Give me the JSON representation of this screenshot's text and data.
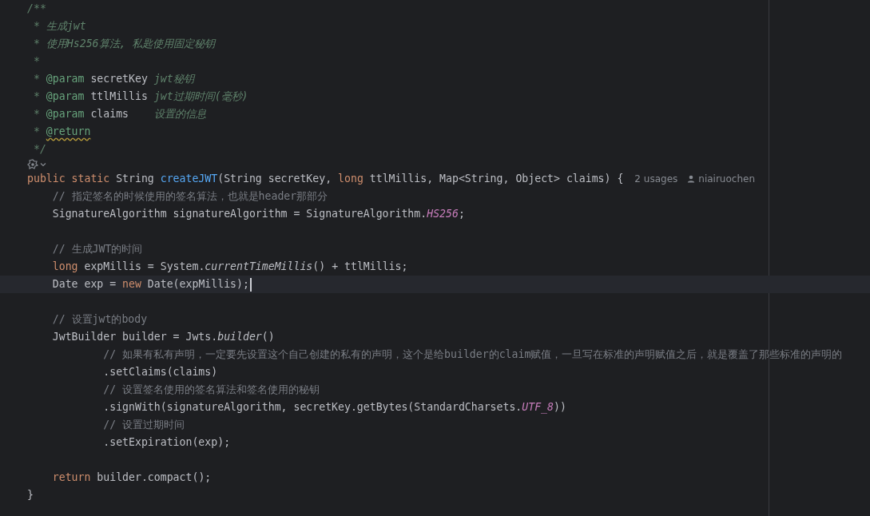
{
  "editor": {
    "lines": [
      {
        "kind": "code",
        "current": false,
        "tokens": [
          {
            "kind": "doc",
            "text": "/**"
          }
        ]
      },
      {
        "kind": "code",
        "current": false,
        "tokens": [
          {
            "kind": "doc",
            "text": " * 生成jwt"
          }
        ]
      },
      {
        "kind": "code",
        "current": false,
        "tokens": [
          {
            "kind": "doc",
            "text": " * 使用Hs256算法, 私匙使用固定秘钥"
          }
        ]
      },
      {
        "kind": "code",
        "current": false,
        "tokens": [
          {
            "kind": "doc",
            "text": " *"
          }
        ]
      },
      {
        "kind": "code",
        "current": false,
        "tokens": [
          {
            "kind": "doc",
            "text": " * "
          },
          {
            "kind": "doctag",
            "text": "@param"
          },
          {
            "kind": "docparam",
            "text": " secretKey"
          },
          {
            "kind": "doc",
            "text": " jwt秘钥"
          }
        ]
      },
      {
        "kind": "code",
        "current": false,
        "tokens": [
          {
            "kind": "doc",
            "text": " * "
          },
          {
            "kind": "doctag",
            "text": "@param"
          },
          {
            "kind": "docparam",
            "text": " ttlMillis"
          },
          {
            "kind": "doc",
            "text": " jwt过期时间(毫秒)"
          }
        ]
      },
      {
        "kind": "code",
        "current": false,
        "tokens": [
          {
            "kind": "doc",
            "text": " * "
          },
          {
            "kind": "doctag",
            "text": "@param"
          },
          {
            "kind": "docparam",
            "text": " claims"
          },
          {
            "kind": "doc",
            "text": "    设置的信息"
          }
        ]
      },
      {
        "kind": "code",
        "current": false,
        "tokens": [
          {
            "kind": "doc",
            "text": " * "
          },
          {
            "kind": "doctag-warn",
            "text": "@return"
          }
        ]
      },
      {
        "kind": "code",
        "current": false,
        "tokens": [
          {
            "kind": "doc",
            "text": " */"
          }
        ]
      },
      {
        "kind": "marker",
        "current": false
      },
      {
        "kind": "code",
        "current": false,
        "tokens": [
          {
            "kind": "keyword",
            "text": "public static "
          },
          {
            "kind": "plain",
            "text": "String "
          },
          {
            "kind": "method",
            "text": "createJWT"
          },
          {
            "kind": "plain",
            "text": "(String secretKey, "
          },
          {
            "kind": "keyword",
            "text": "long "
          },
          {
            "kind": "plain",
            "text": "ttlMillis, Map<String, Object> claims) {"
          }
        ],
        "usages": "2 usages",
        "author": "niairuochen"
      },
      {
        "kind": "code",
        "current": false,
        "tokens": [
          {
            "kind": "comment",
            "text": "    // 指定签名的时候使用的签名算法，也就是header那部分"
          }
        ]
      },
      {
        "kind": "code",
        "current": false,
        "tokens": [
          {
            "kind": "plain",
            "text": "    SignatureAlgorithm signatureAlgorithm = SignatureAlgorithm."
          },
          {
            "kind": "constant",
            "text": "HS256"
          },
          {
            "kind": "plain",
            "text": ";"
          }
        ]
      },
      {
        "kind": "code",
        "current": false
      },
      {
        "kind": "code",
        "current": false,
        "tokens": [
          {
            "kind": "comment",
            "text": "    // 生成JWT的时间"
          }
        ]
      },
      {
        "kind": "code",
        "current": false,
        "tokens": [
          {
            "kind": "keyword",
            "text": "    long "
          },
          {
            "kind": "plain",
            "text": "expMillis = System."
          },
          {
            "kind": "static",
            "text": "currentTimeMillis"
          },
          {
            "kind": "plain",
            "text": "() + ttlMillis;"
          }
        ]
      },
      {
        "kind": "code",
        "current": true,
        "tokens": [
          {
            "kind": "plain",
            "text": "    Date exp = "
          },
          {
            "kind": "keyword",
            "text": "new "
          },
          {
            "kind": "plain",
            "text": "Date(expMillis);"
          }
        ]
      },
      {
        "kind": "code",
        "current": false
      },
      {
        "kind": "code",
        "current": false,
        "tokens": [
          {
            "kind": "comment",
            "text": "    // 设置jwt的body"
          }
        ]
      },
      {
        "kind": "code",
        "current": false,
        "tokens": [
          {
            "kind": "plain",
            "text": "    JwtBuilder builder = Jwts."
          },
          {
            "kind": "static",
            "text": "builder"
          },
          {
            "kind": "plain",
            "text": "()"
          }
        ]
      },
      {
        "kind": "code",
        "current": false,
        "tokens": [
          {
            "kind": "comment",
            "text": "            // 如果有私有声明，一定要先设置这个自己创建的私有的声明，这个是给builder的claim赋值，一旦写在标准的声明赋值之后，就是覆盖了那些标准的声明的"
          }
        ]
      },
      {
        "kind": "code",
        "current": false,
        "tokens": [
          {
            "kind": "plain",
            "text": "            .setClaims(claims)"
          }
        ]
      },
      {
        "kind": "code",
        "current": false,
        "tokens": [
          {
            "kind": "comment",
            "text": "            // 设置签名使用的签名算法和签名使用的秘钥"
          }
        ]
      },
      {
        "kind": "code",
        "current": false,
        "tokens": [
          {
            "kind": "plain",
            "text": "            .signWith(signatureAlgorithm, secretKey.getBytes(StandardCharsets."
          },
          {
            "kind": "constant",
            "text": "UTF_8"
          },
          {
            "kind": "plain",
            "text": "))"
          }
        ]
      },
      {
        "kind": "code",
        "current": false,
        "tokens": [
          {
            "kind": "comment",
            "text": "            // 设置过期时间"
          }
        ]
      },
      {
        "kind": "code",
        "current": false,
        "tokens": [
          {
            "kind": "plain",
            "text": "            .setExpiration(exp);"
          }
        ]
      },
      {
        "kind": "code",
        "current": false
      },
      {
        "kind": "code",
        "current": false,
        "tokens": [
          {
            "kind": "keyword",
            "text": "    return "
          },
          {
            "kind": "plain",
            "text": "builder.compact();"
          }
        ]
      },
      {
        "kind": "code",
        "current": false,
        "tokens": [
          {
            "kind": "plain",
            "text": "}"
          }
        ]
      }
    ]
  }
}
